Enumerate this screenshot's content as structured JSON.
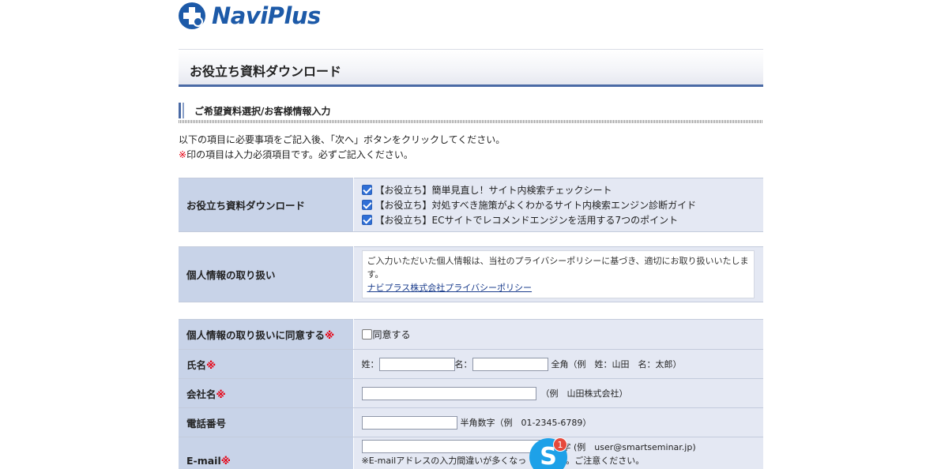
{
  "logo": {
    "text": "NaviPlus"
  },
  "page_title": "お役立ち資料ダウンロード",
  "section_heading": "ご希望資料選択/お客様情報入力",
  "intro": {
    "line1": "以下の項目に必要事項をご記入後、「次へ」ボタンをクリックしてください。",
    "line2_mark": "※",
    "line2": "印の項目は入力必須項目です。必ずご記入ください。"
  },
  "downloads": {
    "label": "お役立ち資料ダウンロード",
    "items": [
      "【お役立ち】簡単見直し！サイト内検索チェックシート",
      "【お役立ち】対処すべき施策がよくわかるサイト内検索エンジン診断ガイド",
      "【お役立ち】ECサイトでレコメンドエンジンを活用する7つのポイント"
    ]
  },
  "privacy": {
    "label": "個人情報の取り扱い",
    "text": "ご入力いただいた個人情報は、当社のプライバシーポリシーに基づき、適切にお取り扱いいたします。",
    "link": "ナビプラス株式会社プライバシーポリシー"
  },
  "fields": {
    "agree": {
      "label": "個人情報の取り扱いに同意する",
      "mark": "※",
      "checkbox_label": "同意する"
    },
    "name": {
      "label": "氏名",
      "mark": "※",
      "last": "姓：",
      "first": "名：",
      "hint": "全角（例　姓：山田　名：太郎）"
    },
    "company": {
      "label": "会社名",
      "mark": "※",
      "hint": "（例　山田株式会社）"
    },
    "phone": {
      "label": "電話番号",
      "hint": "半角数字（例　01-2345-6789）"
    },
    "email": {
      "label": "E-mail",
      "mark": "※",
      "hint": "字 (例　user@smartseminar.jp)",
      "note": "※E-mailアドレスの入力間違いが多くなっ",
      "note2": "。ご注意ください。"
    }
  },
  "skype": {
    "letter": "S",
    "badge": "1"
  }
}
